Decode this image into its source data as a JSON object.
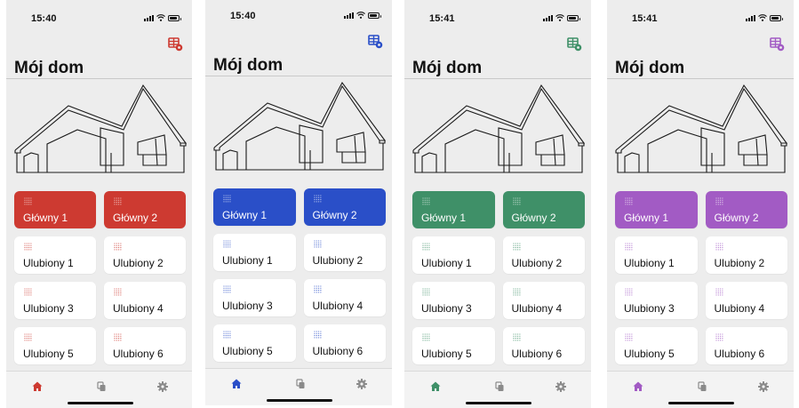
{
  "screens": [
    {
      "theme": "red",
      "accent": "#cd3a31",
      "status": {
        "time": "15:40"
      }
    },
    {
      "theme": "blue",
      "accent": "#2a4fc8",
      "status": {
        "time": "15:40"
      }
    },
    {
      "theme": "green",
      "accent": "#3f9068",
      "status": {
        "time": "15:41"
      }
    },
    {
      "theme": "purple",
      "accent": "#a25bc4",
      "status": {
        "time": "15:41"
      }
    }
  ],
  "header": {
    "title": "Mój dom"
  },
  "tiles": [
    {
      "label": "Główny 1",
      "kind": "primary"
    },
    {
      "label": "Główny 2",
      "kind": "primary"
    },
    {
      "label": "Ulubiony 1",
      "kind": "favorite"
    },
    {
      "label": "Ulubiony 2",
      "kind": "favorite"
    },
    {
      "label": "Ulubiony 3",
      "kind": "favorite"
    },
    {
      "label": "Ulubiony 4",
      "kind": "favorite"
    },
    {
      "label": "Ulubiony 5",
      "kind": "favorite"
    },
    {
      "label": "Ulubiony 6",
      "kind": "favorite"
    }
  ],
  "icons": {
    "settings": "grid-settings-icon",
    "house": "house-outline-drawing",
    "tile": "dotted-light-icon",
    "tab_home": "home-icon",
    "tab_scenes": "copy-scenes-icon",
    "tab_settings": "gear-icon",
    "status_signal": "signal-icon",
    "status_wifi": "wifi-icon",
    "status_battery": "battery-icon"
  }
}
